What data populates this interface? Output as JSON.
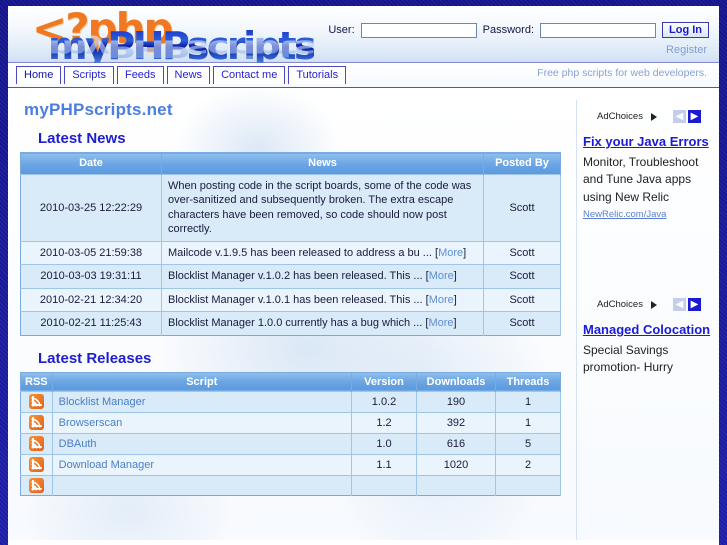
{
  "site": {
    "logo_php": "<?php",
    "logo_name": "myPHPscripts",
    "title": "myPHPscripts.net",
    "tagline": "Free php scripts for web developers."
  },
  "login": {
    "user_label": "User:",
    "user_value": "",
    "user_placeholder": "",
    "password_label": "Password:",
    "password_value": "",
    "password_placeholder": "",
    "submit_label": "Log In",
    "register_label": "Register"
  },
  "nav": {
    "tabs": [
      {
        "label": "Home",
        "active": true
      },
      {
        "label": "Scripts",
        "active": false
      },
      {
        "label": "Feeds",
        "active": false
      },
      {
        "label": "News",
        "active": false
      },
      {
        "label": "Contact me",
        "active": false
      },
      {
        "label": "Tutorials",
        "active": false
      }
    ]
  },
  "news": {
    "heading": "Latest News",
    "columns": [
      "Date",
      "News",
      "Posted By"
    ],
    "rows": [
      {
        "date": "2010-03-25 12:22:29",
        "text": "When posting code in the script boards, some of the code was over-sanitized and subsequently broken. The extra escape characters have been removed, so code should now post correctly.",
        "more": "",
        "by": "Scott"
      },
      {
        "date": "2010-03-05 21:59:38",
        "text": "Mailcode v.1.9.5 has been released to address a bu ...",
        "more": "More",
        "by": "Scott"
      },
      {
        "date": "2010-03-03 19:31:11",
        "text": "Blocklist Manager v.1.0.2 has been released. This ...",
        "more": "More",
        "by": "Scott"
      },
      {
        "date": "2010-02-21 12:34:20",
        "text": "Blocklist Manager v.1.0.1 has been released. This ...",
        "more": "More",
        "by": "Scott"
      },
      {
        "date": "2010-02-21 11:25:43",
        "text": "Blocklist Manager 1.0.0 currently has a bug which ...",
        "more": "More",
        "by": "Scott"
      }
    ]
  },
  "releases": {
    "heading": "Latest Releases",
    "columns": [
      "RSS",
      "Script",
      "Version",
      "Downloads",
      "Threads"
    ],
    "rows": [
      {
        "rss": "rss-icon",
        "script": "Blocklist Manager",
        "version": "1.0.2",
        "downloads": "190",
        "threads": "1"
      },
      {
        "rss": "rss-icon",
        "script": "Browserscan",
        "version": "1.2",
        "downloads": "392",
        "threads": "1"
      },
      {
        "rss": "rss-icon",
        "script": "DBAuth",
        "version": "1.0",
        "downloads": "616",
        "threads": "5"
      },
      {
        "rss": "rss-icon",
        "script": "Download Manager",
        "version": "1.1",
        "downloads": "1020",
        "threads": "2"
      },
      {
        "rss": "rss-icon",
        "script": "",
        "version": "",
        "downloads": "",
        "threads": ""
      }
    ]
  },
  "ads": {
    "choices_label": "AdChoices",
    "prev_glyph": "◀",
    "next_glyph": "▶",
    "items": [
      {
        "title": "Fix your Java Errors",
        "body": "Monitor, Troubleshoot and Tune Java apps using New Relic",
        "url": "NewRelic.com/Java"
      },
      {
        "title": "Managed Colocation",
        "body": "Special Savings promotion- Hurry",
        "url": ""
      }
    ]
  },
  "colors": {
    "frame": "#1a1a9e",
    "accent_blue": "#1e1ecc",
    "link_blue": "#4b7fc4",
    "table_header": "#6aa4e2",
    "row_alt_a": "#d9eaf9",
    "row_alt_b": "#eaf4fd",
    "orange": "#f07820"
  }
}
